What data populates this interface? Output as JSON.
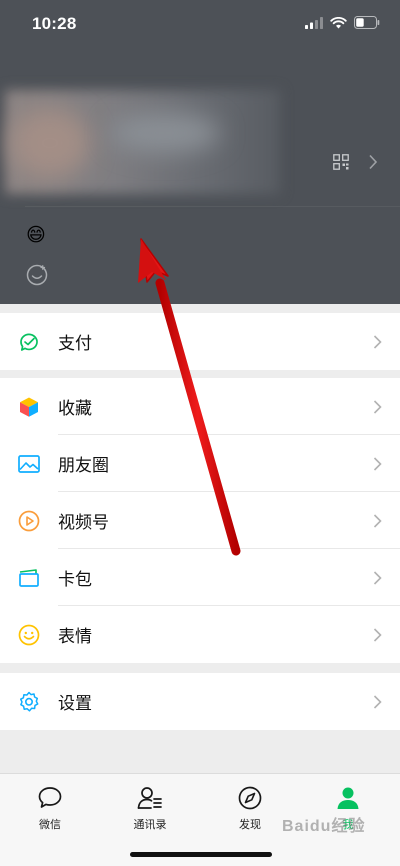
{
  "status_bar": {
    "time": "10:28"
  },
  "header": {
    "status_emoji": "😄"
  },
  "menu": {
    "pay": {
      "label": "支付"
    },
    "favorites": {
      "label": "收藏"
    },
    "moments": {
      "label": "朋友圈"
    },
    "channels": {
      "label": "视频号"
    },
    "cards": {
      "label": "卡包"
    },
    "stickers": {
      "label": "表情"
    },
    "settings": {
      "label": "设置"
    }
  },
  "tabbar": {
    "chats": "微信",
    "contacts": "通讯录",
    "discover": "发现",
    "me": "我",
    "active": "me"
  },
  "watermark": "Baidu经验",
  "colors": {
    "accent": "#07c160",
    "header_overlay": "#4d5157",
    "arrow": "#e01010"
  }
}
